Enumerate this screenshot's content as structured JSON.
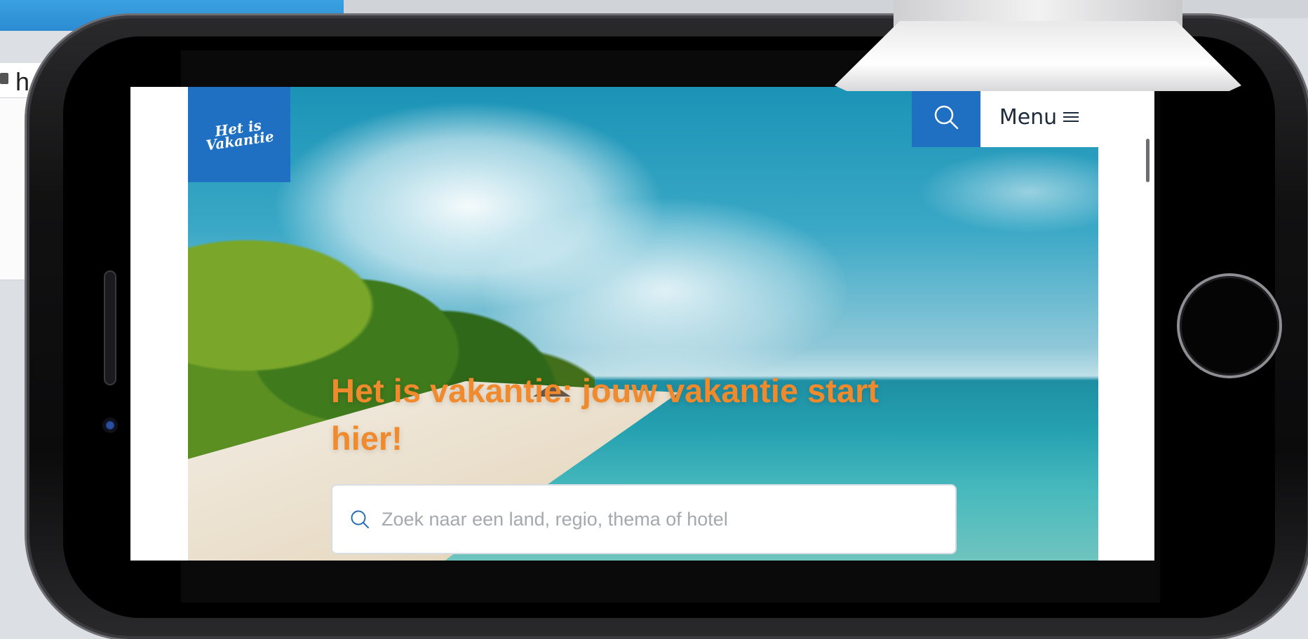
{
  "browser": {
    "url_fragment": "h"
  },
  "site": {
    "logo_text_line1": "Het is",
    "logo_text_line2": "Vakantie",
    "menu_label": "Menu",
    "menu_icon": "hamburger-icon",
    "search_icon": "search-icon",
    "headline": "Het is vakantie: jouw vakantie start hier!",
    "search_placeholder": "Zoek naar een land, regio, thema of hotel"
  },
  "colors": {
    "brand_blue": "#1f6fc2",
    "headline_orange": "#f08a2c"
  }
}
